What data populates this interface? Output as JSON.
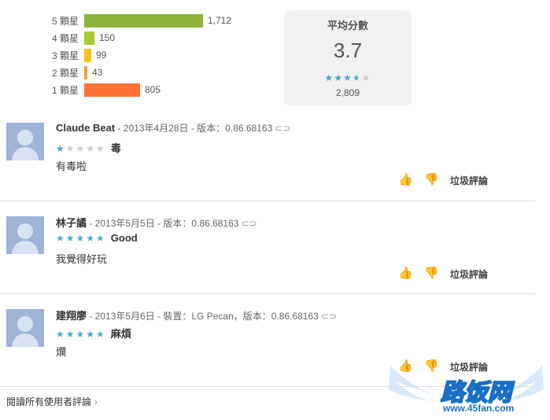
{
  "histogram": [
    {
      "label": "5 顆星",
      "count": "1,712",
      "fraction": 1.0,
      "color": "#8db33a"
    },
    {
      "label": "4 顆星",
      "count": "150",
      "fraction": 0.088,
      "color": "#a8cc2c"
    },
    {
      "label": "3 顆星",
      "count": "99",
      "fraction": 0.058,
      "color": "#f0c419"
    },
    {
      "label": "2 顆星",
      "count": "43",
      "fraction": 0.025,
      "color": "#f0a533"
    },
    {
      "label": "1 顆星",
      "count": "805",
      "fraction": 0.47,
      "color": "#ff7337"
    }
  ],
  "average": {
    "title": "平均分數",
    "value": "3.7",
    "stars": "★★★★★",
    "rating": 3.7,
    "count": "2,809"
  },
  "reviews": [
    {
      "author": "Claude Beat",
      "meta": " - 2013年4月28日 - 版本：0.86.68163",
      "stars_on": "★",
      "stars_off": "★★★★",
      "title": "毒",
      "body": "有毒啦",
      "spam": "垃圾評論"
    },
    {
      "author": "林子譎",
      "meta": " - 2013年5月5日 - 版本：0.86.68163",
      "stars_on": "★★★★★",
      "stars_off": "",
      "title": "Good",
      "body": "我覺得好玩",
      "spam": "垃圾評論"
    },
    {
      "author": "建翔廖",
      "meta": " - 2013年5月6日 - 裝置：LG Pecan，版本：0.86.68163",
      "stars_on": "★★★★★",
      "stars_off": "",
      "title": "麻煩",
      "body": "爛",
      "spam": "垃圾評論"
    }
  ],
  "link_glyph": "⊂⊃",
  "thumb_up": "👍",
  "thumb_down": "👎",
  "read_all": "閱讀所有使用者評論",
  "read_all_chevron": "›",
  "watermark": {
    "text": "路饭网",
    "url": "www.45fan.com"
  }
}
